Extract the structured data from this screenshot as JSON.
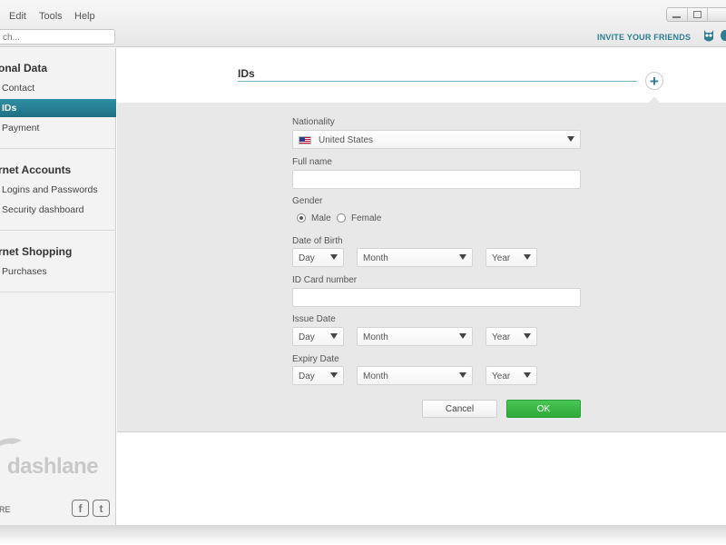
{
  "menu": {
    "edit": "Edit",
    "tools": "Tools",
    "help": "Help"
  },
  "search": {
    "placeholder": "ch..."
  },
  "header": {
    "invite": "INVITE YOUR FRIENDS"
  },
  "sidebar": {
    "sections": [
      {
        "title": "onal Data",
        "items": [
          "Contact",
          "IDs",
          "Payment"
        ]
      },
      {
        "title": "rnet Accounts",
        "items": [
          "Logins and Passwords",
          "Security dashboard"
        ]
      },
      {
        "title": "rnet Shopping",
        "items": [
          "Purchases"
        ]
      }
    ],
    "selected": "IDs",
    "logo": "dashlane",
    "share_label": "RE"
  },
  "main": {
    "section_title": "IDs",
    "form": {
      "nationality_label": "Nationality",
      "nationality_value": "United States",
      "fullname_label": "Full name",
      "gender_label": "Gender",
      "gender_male": "Male",
      "gender_female": "Female",
      "gender_selected": "Male",
      "dob_label": "Date of Birth",
      "idcard_label": "ID Card number",
      "issue_label": "Issue Date",
      "expiry_label": "Expiry Date",
      "day": "Day",
      "month": "Month",
      "year": "Year",
      "cancel": "Cancel",
      "ok": "OK"
    }
  },
  "colors": {
    "accent": "#2e7d93",
    "selected": "#1f6f83",
    "ok": "#36b043"
  }
}
